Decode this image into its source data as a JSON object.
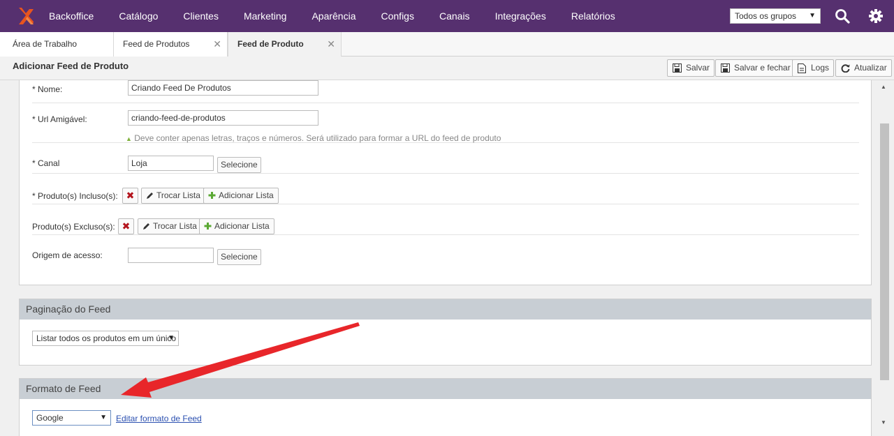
{
  "nav": {
    "items": [
      "Backoffice",
      "Catálogo",
      "Clientes",
      "Marketing",
      "Aparência",
      "Configs",
      "Canais",
      "Integrações",
      "Relatórios"
    ],
    "group_select": "Todos os grupos",
    "brand_color": "#56306f",
    "logo_color": "#e8541e"
  },
  "tabs": [
    {
      "label": "Área de Trabalho"
    },
    {
      "label": "Feed de Produtos",
      "close": "✕"
    },
    {
      "label": "Feed de Produto",
      "close": "✕"
    }
  ],
  "header": {
    "title": "Adicionar Feed de Produto",
    "buttons": {
      "save": "Salvar",
      "save_close": "Salvar e fechar",
      "logs": "Logs",
      "refresh": "Atualizar"
    }
  },
  "form": {
    "nome": {
      "label": "* Nome:",
      "value": "Criando Feed De Produtos"
    },
    "url": {
      "label": "* Url Amigável:",
      "value": "criando-feed-de-produtos",
      "hint": "Deve conter apenas letras, traços e números. Será utilizado para formar a URL do feed de produto"
    },
    "canal": {
      "label": "* Canal",
      "value": "Loja",
      "button": "Selecione"
    },
    "incluso": {
      "label": "* Produto(s) Incluso(s):",
      "remove": "✖",
      "swap": "Trocar Lista",
      "add": "Adicionar Lista"
    },
    "excluso": {
      "label": "Produto(s) Excluso(s):",
      "remove": "✖",
      "swap": "Trocar Lista",
      "add": "Adicionar Lista"
    },
    "origem": {
      "label": "Origem de acesso:",
      "value": "",
      "button": "Selecione"
    }
  },
  "paginacao": {
    "title": "Paginação do Feed",
    "select": "Listar todos os produtos em um único"
  },
  "formato": {
    "title": "Formato de Feed",
    "select": "Google",
    "link": "Editar formato de Feed"
  },
  "annotation_color": "#e8262a"
}
